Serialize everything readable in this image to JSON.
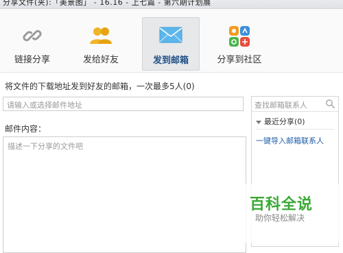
{
  "window": {
    "title": "分享文件(夹):「美景图」 - 16.16 - 上七篇 - 第六期计划展"
  },
  "tabs": [
    {
      "label": "链接分享",
      "icon": "link-icon"
    },
    {
      "label": "发给好友",
      "icon": "friends-icon"
    },
    {
      "label": "发到邮箱",
      "icon": "mail-icon",
      "active": true
    },
    {
      "label": "分享到社区",
      "icon": "community-icon"
    }
  ],
  "email": {
    "instruction": "将文件的下载地址发到好友的邮箱，一次最多5人(0)",
    "input_placeholder": "请输入或选择邮件地址",
    "content_label": "邮件内容：",
    "content_placeholder": "描述一下分享的文件吧"
  },
  "contacts": {
    "search_placeholder": "查找邮箱联系人",
    "recent_label": "最近分享(0)",
    "import_link": "一键导入邮箱联系人"
  },
  "watermark": {
    "title": "百科全说",
    "subtitle": "助你轻松解决"
  },
  "colors": {
    "active_tab_text": "#1f4f86",
    "link": "#1f5ea8",
    "watermark_green": "#3aa935"
  }
}
